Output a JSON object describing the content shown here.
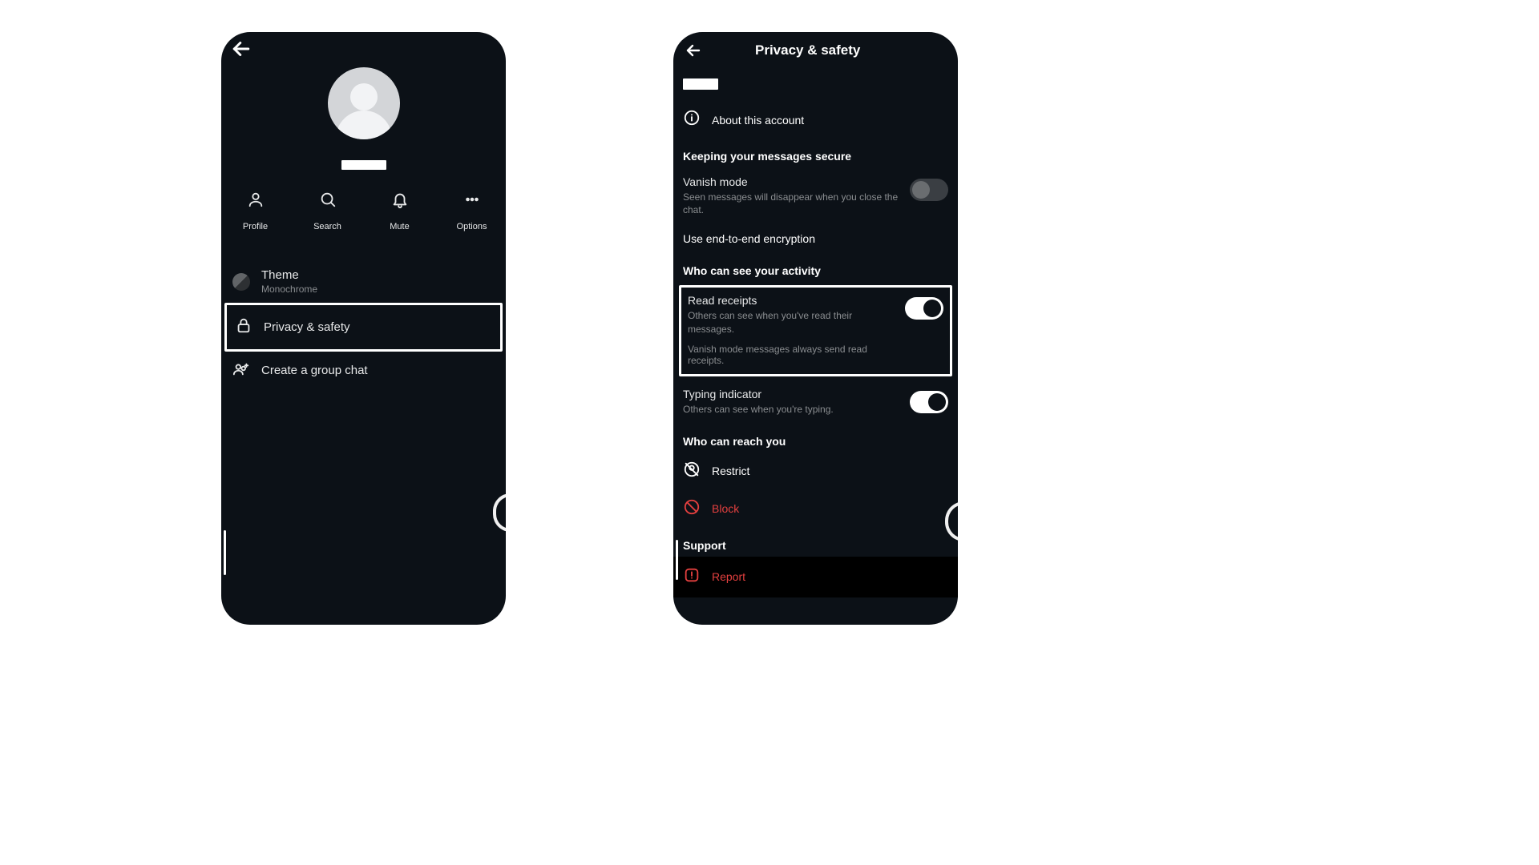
{
  "left": {
    "actions": {
      "profile": "Profile",
      "search": "Search",
      "mute": "Mute",
      "options": "Options"
    },
    "theme": {
      "title": "Theme",
      "value": "Monochrome"
    },
    "privacy": "Privacy & safety",
    "create_group": "Create a group chat"
  },
  "right": {
    "title": "Privacy & safety",
    "about": "About this account",
    "section_secure": "Keeping your messages secure",
    "vanish": {
      "title": "Vanish mode",
      "desc": "Seen messages will disappear when you close the chat."
    },
    "encryption": "Use end-to-end encryption",
    "section_activity": "Who can see your activity",
    "read_receipts": {
      "title": "Read receipts",
      "desc": "Others can see when you've read their messages.",
      "note": "Vanish mode messages always send read receipts."
    },
    "typing": {
      "title": "Typing indicator",
      "desc": "Others can see when you're typing."
    },
    "section_reach": "Who can reach you",
    "restrict": "Restrict",
    "block": "Block",
    "section_support": "Support",
    "report": "Report"
  }
}
